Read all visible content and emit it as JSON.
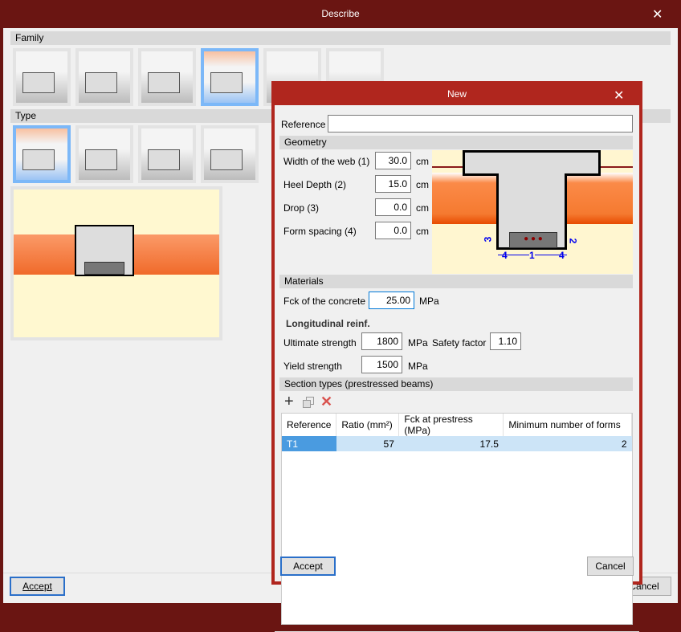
{
  "outer": {
    "title": "Describe",
    "family_label": "Family",
    "type_label": "Type",
    "accept": "Accept",
    "cancel": "Cancel"
  },
  "dialog": {
    "title": "New",
    "reference_label": "Reference",
    "reference_value": "",
    "geometry_label": "Geometry",
    "geometry": [
      {
        "label": "Width of the web (1)",
        "value": "30.0",
        "unit": "cm"
      },
      {
        "label": "Heel Depth (2)",
        "value": "15.0",
        "unit": "cm"
      },
      {
        "label": "Drop (3)",
        "value": "0.0",
        "unit": "cm"
      },
      {
        "label": "Form spacing (4)",
        "value": "0.0",
        "unit": "cm"
      }
    ],
    "diagram_labels": {
      "d1": "1",
      "d2": "2",
      "d3": "3",
      "d4a": "4",
      "d4b": "4"
    },
    "materials_label": "Materials",
    "fck_label": "Fck of the concrete",
    "fck_value": "25.00",
    "mpa": "MPa",
    "long_reinf": "Longitudinal reinf.",
    "ult_label": "Ultimate strength",
    "ult_value": "1800",
    "sf_label": "Safety factor",
    "sf_value": "1.10",
    "yield_label": "Yield strength",
    "yield_value": "1500",
    "section_types_label": "Section types (prestressed beams)",
    "table": {
      "headers": [
        "Reference",
        "Ratio (mm²)",
        "Fck at prestress (MPa)",
        "Minimum number of forms"
      ],
      "rows": [
        [
          "T1",
          "57",
          "17.5",
          "2"
        ]
      ]
    },
    "accept": "Accept",
    "cancel": "Cancel"
  }
}
